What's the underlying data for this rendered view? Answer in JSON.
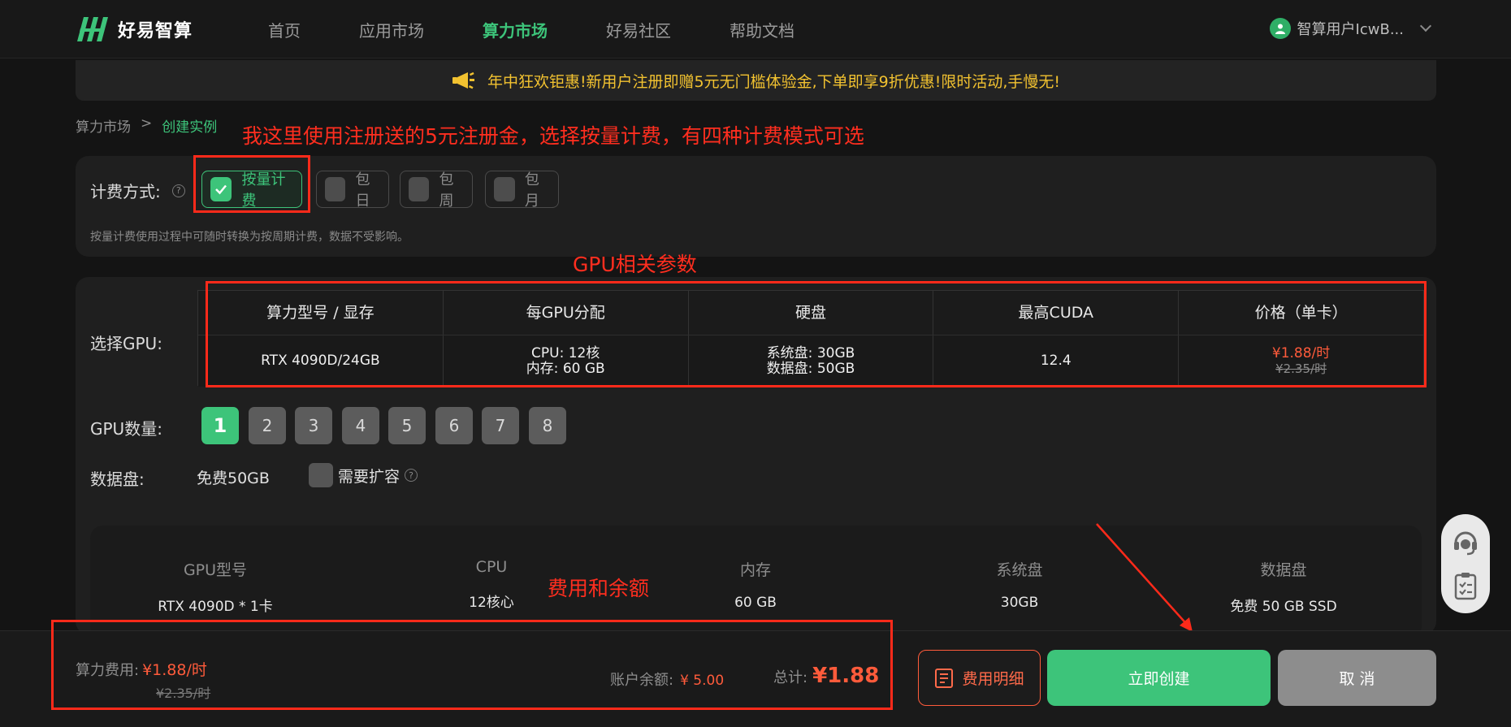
{
  "brand": {
    "name": "好易智算"
  },
  "nav": {
    "items": [
      {
        "label": "首页",
        "active": false
      },
      {
        "label": "应用市场",
        "active": false
      },
      {
        "label": "算力市场",
        "active": true
      },
      {
        "label": "好易社区",
        "active": false
      },
      {
        "label": "帮助文档",
        "active": false
      }
    ]
  },
  "user": {
    "name": "智算用户IcwB..."
  },
  "banner": {
    "text": "年中狂欢钜惠!新用户注册即赠5元无门槛体验金,下单即享9折优惠!限时活动,手慢无!"
  },
  "breadcrumb": {
    "parent": "算力市场",
    "separator": ">",
    "current": "创建实例"
  },
  "annotations": {
    "billing": "我这里使用注册送的5元注册金，选择按量计费，有四种计费模式可选",
    "gpu": "GPU相关参数",
    "fees": "费用和余额"
  },
  "billing": {
    "label": "计费方式:",
    "options": [
      {
        "label": "按量计费",
        "active": true
      },
      {
        "label": "包日",
        "active": false
      },
      {
        "label": "包周",
        "active": false
      },
      {
        "label": "包月",
        "active": false
      }
    ],
    "note": "按量计费使用过程中可随时转换为按周期计费，数据不受影响。"
  },
  "gpu": {
    "label": "选择GPU:",
    "headers": [
      "算力型号 / 显存",
      "每GPU分配",
      "硬盘",
      "最高CUDA",
      "价格（单卡）"
    ],
    "row": {
      "model": "RTX 4090D/24GB",
      "cpu": "CPU:  12核",
      "mem": "内存:  60 GB",
      "sys_disk": "系统盘:  30GB",
      "data_disk": "数据盘:  50GB",
      "cuda": "12.4",
      "price": "¥1.88/时",
      "price_old": "¥2.35/时"
    }
  },
  "gpu_count": {
    "label": "GPU数量:",
    "options": [
      "1",
      "2",
      "3",
      "4",
      "5",
      "6",
      "7",
      "8"
    ],
    "selected": "1"
  },
  "data_disk": {
    "label": "数据盘:",
    "value": "免费50GB",
    "expand_label": "需要扩容"
  },
  "summary": {
    "columns": [
      {
        "key": "GPU型号",
        "value": "RTX 4090D * 1卡"
      },
      {
        "key": "CPU",
        "value": "12核心"
      },
      {
        "key": "内存",
        "value": "60 GB"
      },
      {
        "key": "系统盘",
        "value": "30GB"
      },
      {
        "key": "数据盘",
        "value": "免费 50 GB SSD"
      }
    ]
  },
  "footer": {
    "fee_label": "算力费用:",
    "fee_now": "¥1.88/时",
    "fee_old": "¥2.35/时",
    "balance_label": "账户余额:",
    "balance_value": "¥ 5.00",
    "total_label": "总计:",
    "total_value": "¥1.88",
    "detail_button": "费用明细",
    "create_button": "立即创建",
    "cancel_button": "取 消"
  },
  "colors": {
    "accent": "#3dc47a",
    "price": "#ff5b3b",
    "annotation": "#ff2a1a",
    "banner_text": "#f2c230"
  }
}
